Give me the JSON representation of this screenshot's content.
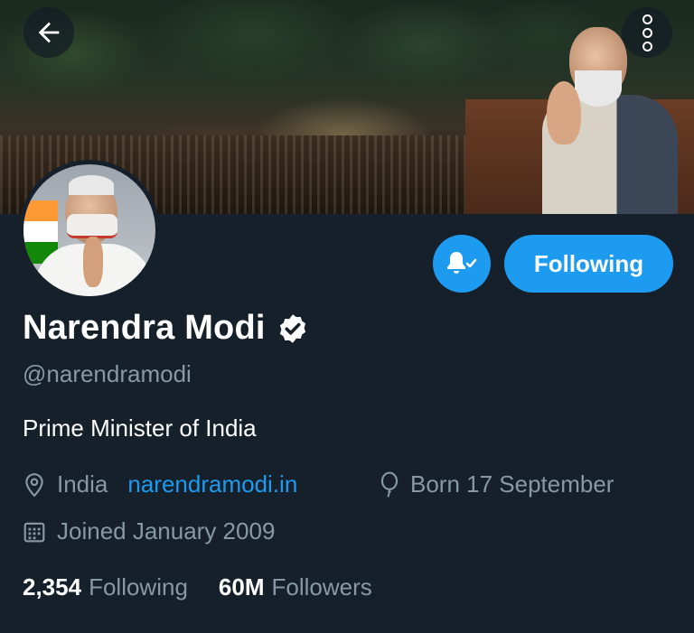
{
  "header": {
    "back_icon": "arrow-left-icon",
    "more_icon": "more-vertical-icon"
  },
  "profile": {
    "name": "Narendra Modi",
    "verified_icon": "verified-badge-icon",
    "handle": "@narendramodi",
    "bio": "Prime Minister of India",
    "location": "India",
    "website": "narendramodi.in",
    "birthday": "Born 17 September",
    "joined": "Joined January 2009"
  },
  "actions": {
    "notifications_icon": "bell-subscribed-icon",
    "follow_label": "Following"
  },
  "stats": {
    "following_count": "2,354",
    "following_label": "Following",
    "followers_count": "60M",
    "followers_label": "Followers"
  },
  "colors": {
    "background": "#15202b",
    "accent": "#1d9bf0",
    "secondary_text": "#8899a6"
  }
}
